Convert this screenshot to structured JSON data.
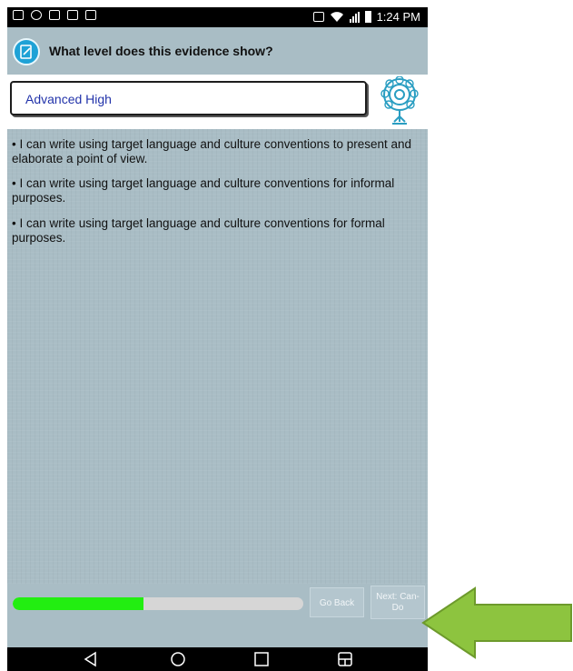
{
  "status_bar": {
    "time": "1:24 PM"
  },
  "header": {
    "title": "What level does this evidence show?"
  },
  "level_select": {
    "value": "Advanced High"
  },
  "statements": [
    "• I can write using target language and culture conventions to present and elaborate a point of view.",
    "• I can write using target language and culture conventions for informal purposes.",
    "• I can write using target language and culture conventions for formal purposes."
  ],
  "progress": {
    "percent": 45,
    "color": "#22ee11"
  },
  "buttons": {
    "go_back": "Go Back",
    "next": "Next: Can-Do"
  },
  "colors": {
    "background": "#a9bdc5",
    "accent": "#1fa2d6",
    "arrow": "#8dc43f"
  },
  "icons": [
    "image-icon",
    "wifi-icon",
    "signal-icon",
    "battery-icon",
    "back-icon",
    "home-icon",
    "recents-icon",
    "menu-icon"
  ]
}
